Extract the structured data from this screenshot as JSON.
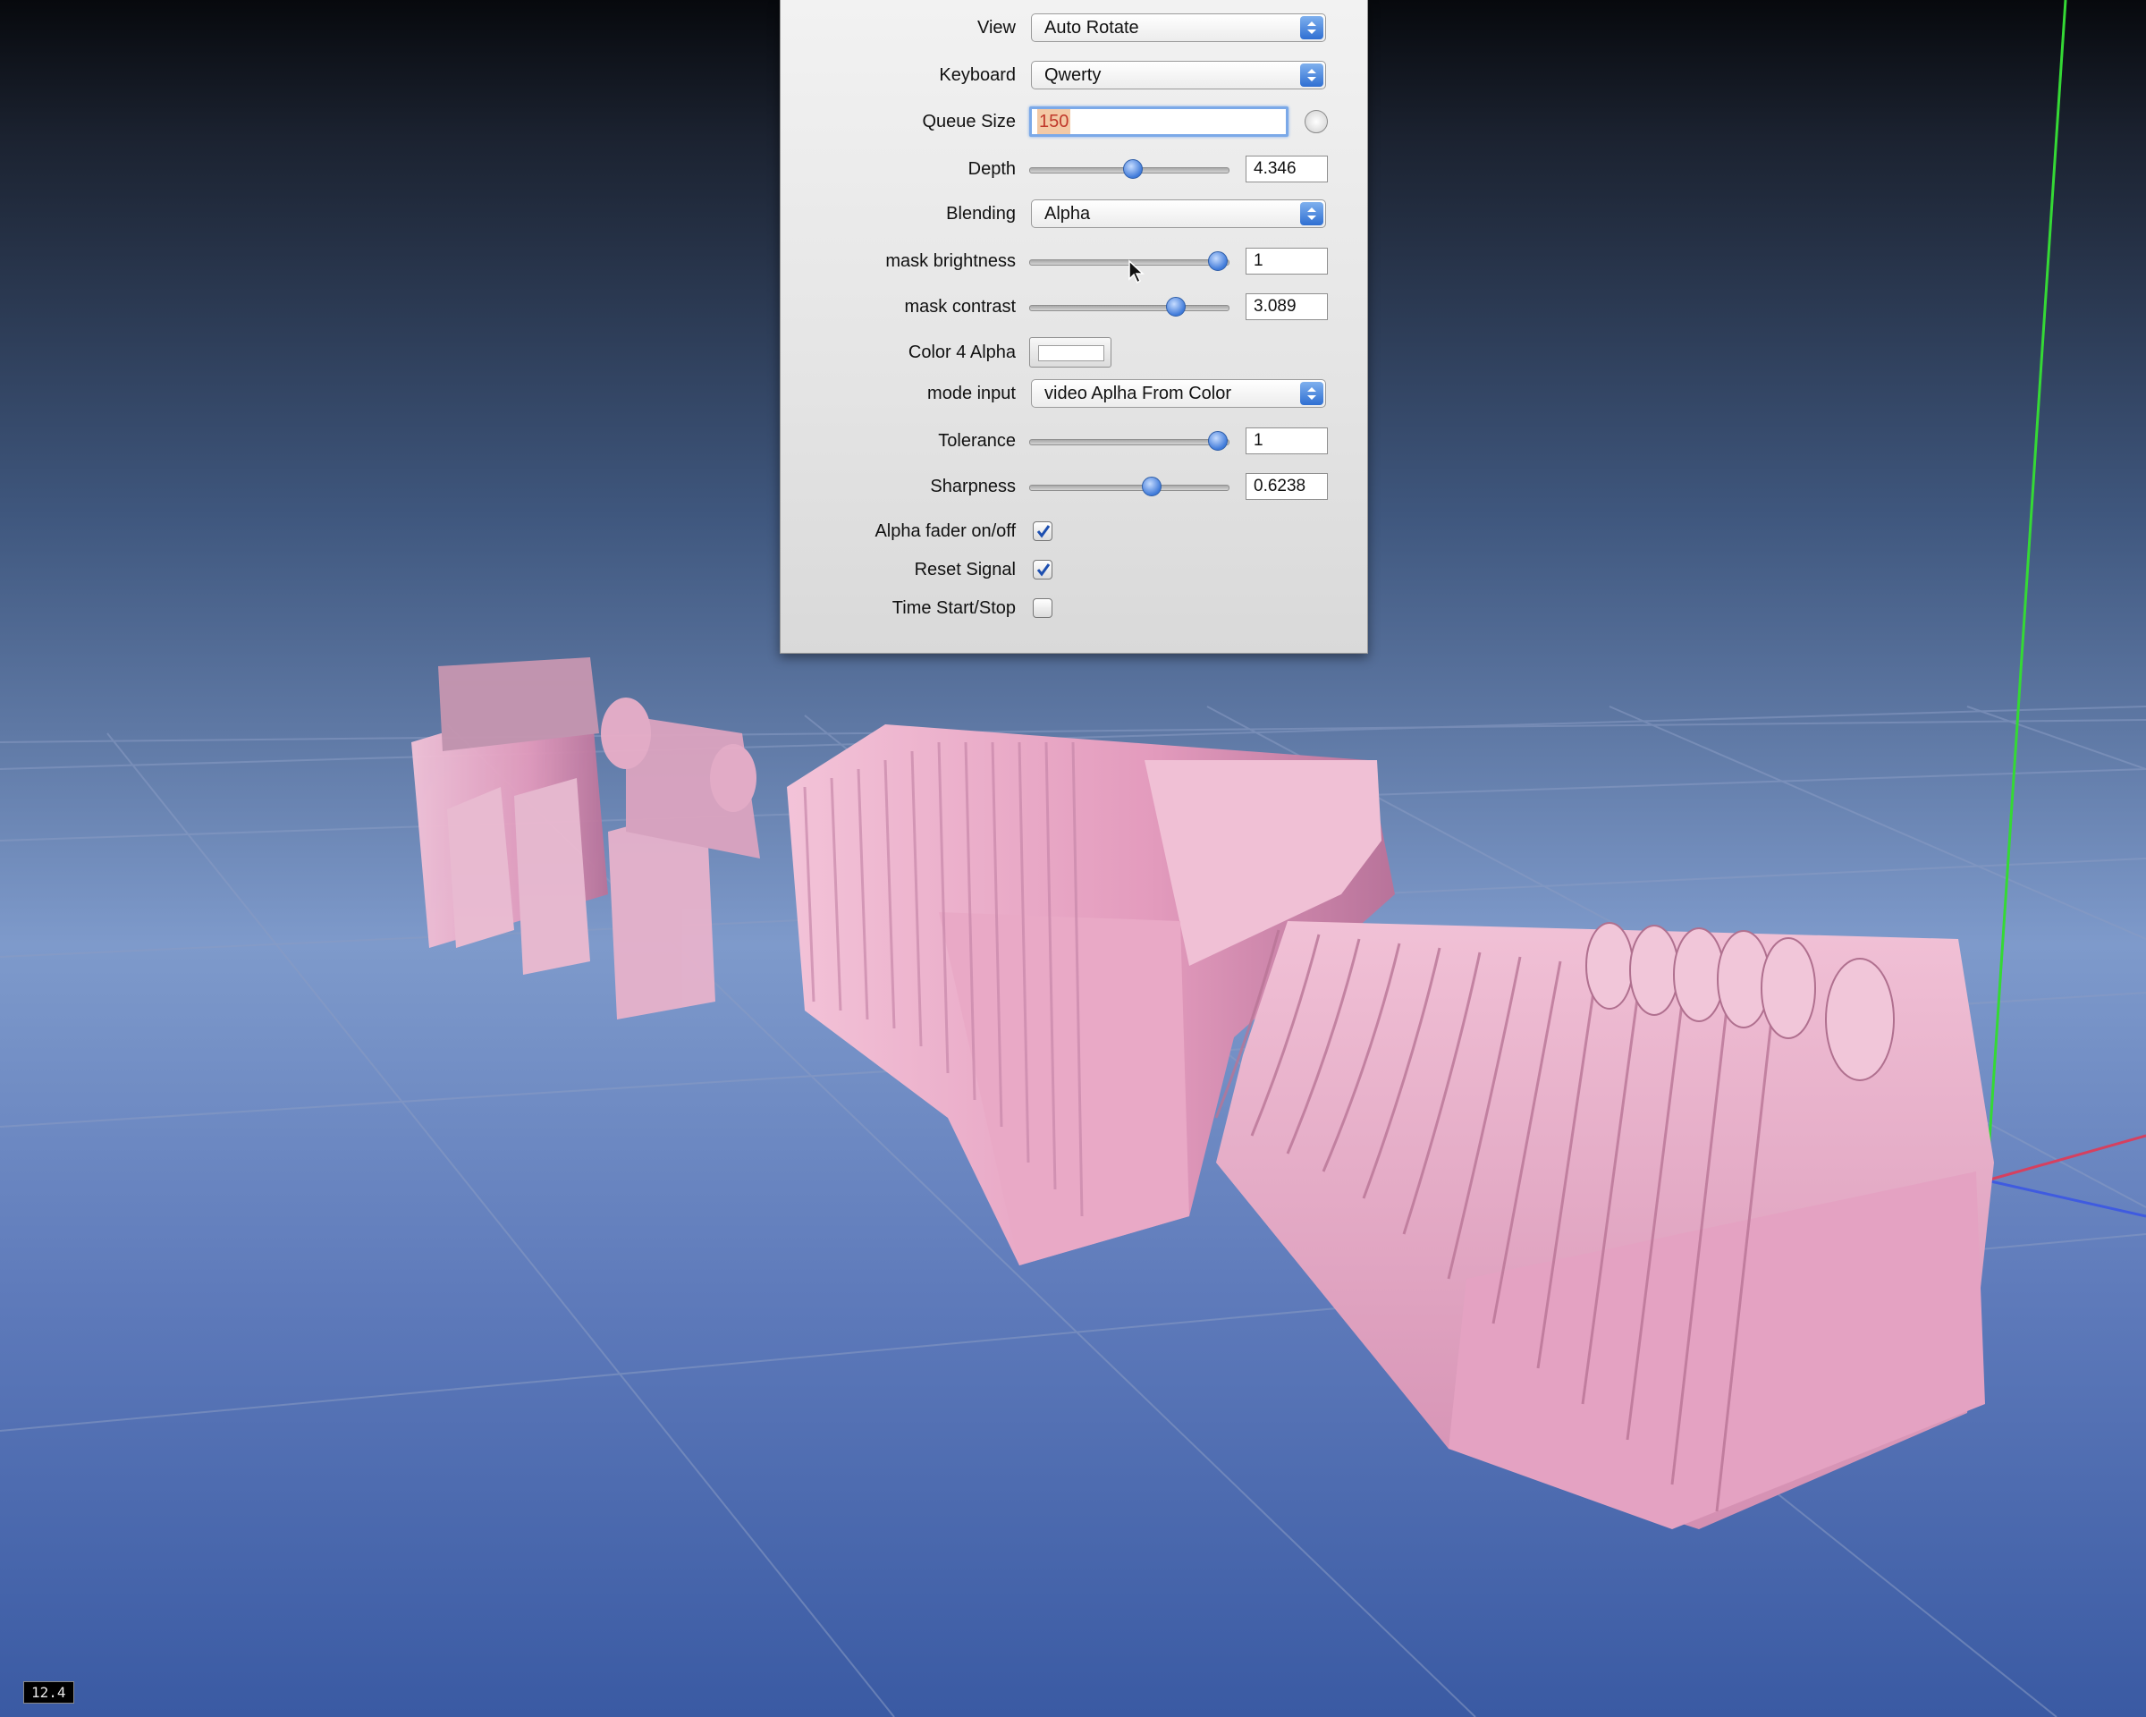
{
  "colors": {
    "background_top": "#0a0c10",
    "background_mid": "#4d6aa3",
    "background_bottom": "#3b5aa2",
    "grid": "#7d8fb8",
    "axis_y": "#3bd43b",
    "axis_x": "#d23b5a",
    "axis_z": "#3b5ad6",
    "figure": "#e6a9c4",
    "accent": "#3f7ad9"
  },
  "panel": {
    "view": {
      "label": "View",
      "value": "Auto Rotate"
    },
    "keyboard": {
      "label": "Keyboard",
      "value": "Qwerty"
    },
    "queue_size": {
      "label": "Queue Size",
      "value": "150"
    },
    "depth": {
      "label": "Depth",
      "value": "4.346",
      "fraction": 0.52
    },
    "blending": {
      "label": "Blending",
      "value": "Alpha"
    },
    "mask_brightness": {
      "label": "mask brightness",
      "value": "1",
      "fraction": 0.94
    },
    "mask_contrast": {
      "label": "mask contrast",
      "value": "3.089",
      "fraction": 0.73
    },
    "color_4_alpha": {
      "label": "Color 4 Alpha",
      "color": "#ffffff"
    },
    "mode_input": {
      "label": "mode input",
      "value": "video Aplha From Color"
    },
    "tolerance": {
      "label": "Tolerance",
      "value": "1",
      "fraction": 0.94
    },
    "sharpness": {
      "label": "Sharpness",
      "value": "0.6238",
      "fraction": 0.61
    },
    "alpha_fader": {
      "label": "Alpha fader on/off",
      "checked": true
    },
    "reset_signal": {
      "label": "Reset Signal",
      "checked": true
    },
    "time_start_stop": {
      "label": "Time Start/Stop",
      "checked": false
    }
  },
  "status": {
    "fps": "12.4"
  }
}
